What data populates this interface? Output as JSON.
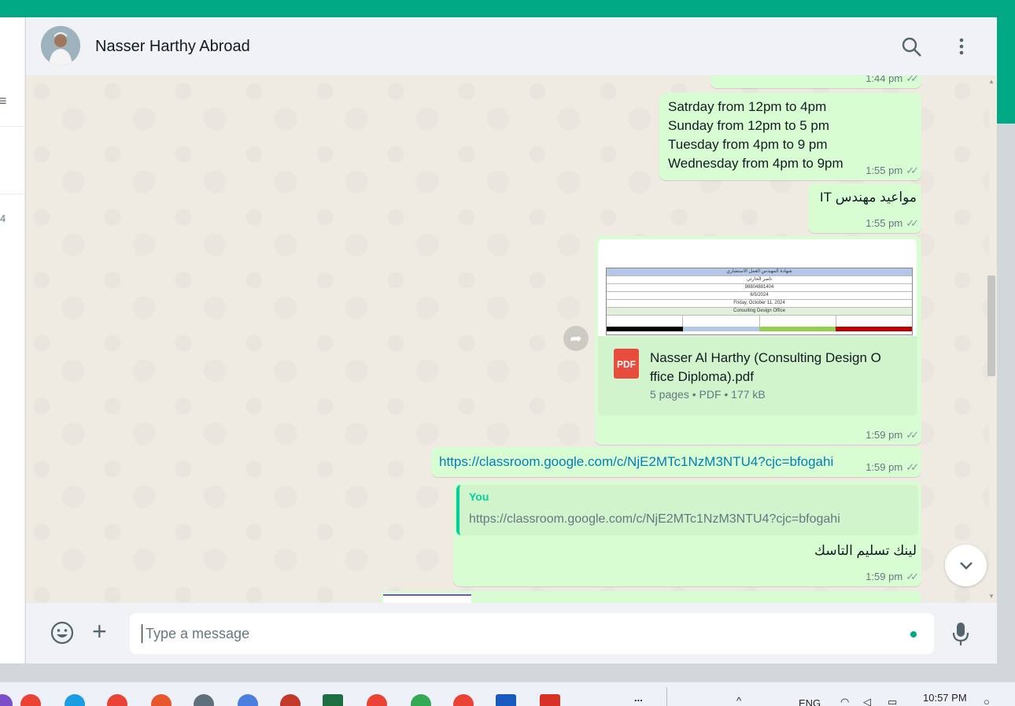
{
  "app": {
    "accent_color": "#00a884"
  },
  "sidebar": {
    "partial_count": "4"
  },
  "header": {
    "contact_name": "Nasser Harthy Abroad",
    "icons": [
      "search-icon",
      "menu-icon"
    ]
  },
  "messages": [
    {
      "time": "1:44 pm"
    },
    {
      "lines": [
        "Satrday from 12pm to 4pm",
        "Sunday from 12pm to 5 pm",
        "Tuesday from 4pm to 9 pm",
        "Wednesday from 4pm to 9pm"
      ],
      "time": "1:55 pm"
    },
    {
      "text": "مواعيد مهندس IT",
      "time": "1:55 pm"
    },
    {
      "file": {
        "name": "Nasser Al Harthy (Consulting Design Office Diploma).pdf",
        "name_line1": "Nasser Al Harthy (Consulting Design O",
        "name_line2": "ffice Diploma).pdf",
        "meta": "5 pages • PDF • 177 kB",
        "badge": "PDF",
        "preview_rows": [
          "شهادة المهندس العمل الاستشاري",
          "ناصر الحارثي",
          "98804881404",
          "6/5/2024",
          "Friday, October 11, 2024",
          "Consulting Design Office"
        ]
      },
      "time": "1:59 pm"
    },
    {
      "link": "https://classroom.google.com/c/NjE2MTc1NzM3NTU4?cjc=bfogahi",
      "time": "1:59 pm"
    },
    {
      "quote_author": "You",
      "quote_text": "https://classroom.google.com/c/NjE2MTc1NzM3NTU4?cjc=bfogahi",
      "text": "لينك تسليم التاسك",
      "time": "1:59 pm"
    }
  ],
  "composer": {
    "placeholder": "Type a message"
  },
  "taskbar": {
    "lang": "ENG",
    "clock": "10:57 PM",
    "overflow": "..."
  }
}
